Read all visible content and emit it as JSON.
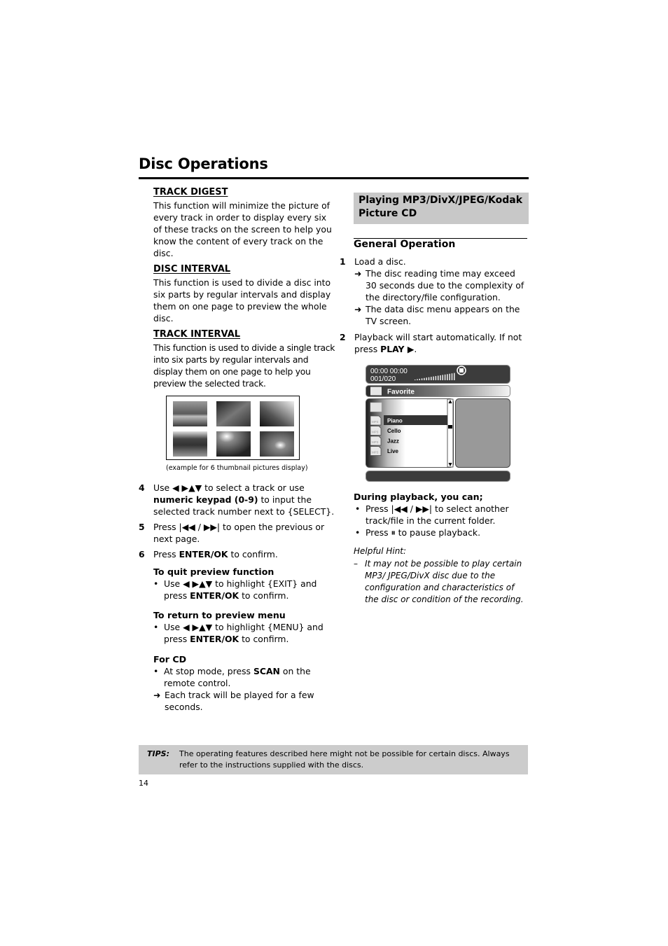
{
  "page": {
    "title": "Disc Operations",
    "page_number": "14"
  },
  "left": {
    "track_digest": {
      "heading": "TRACK DIGEST",
      "text": "This function will minimize the picture of every track in order to display every six of these tracks on the screen to help you know the content of every track on the disc."
    },
    "disc_interval": {
      "heading": "DISC INTERVAL",
      "text": "This function is used to divide a disc into six parts by regular intervals and display them on one page to preview the whole disc."
    },
    "track_interval": {
      "heading": "TRACK INTERVAL",
      "text": "This function is used to divide a single track into six parts by regular intervals and display them on one page to help you preview the selected track."
    },
    "thumbnail_caption": "(example for 6 thumbnail pictures display)",
    "steps": [
      {
        "num": "4",
        "pre": "Use ◀ ▶▲▼ to select a track or use ",
        "bold": "numeric keypad (0-9)",
        "post": " to input the selected track number next to {SELECT}."
      },
      {
        "num": "5",
        "pre": "Press |◀◀ / ▶▶| to open the previous or next page.",
        "bold": "",
        "post": ""
      },
      {
        "num": "6",
        "pre": "Press ",
        "bold": "ENTER/OK",
        "post": " to confirm."
      }
    ],
    "quit": {
      "heading": "To quit preview function",
      "pre": "Use ◀ ▶▲▼ to highlight {EXIT} and press ",
      "bold": "ENTER/OK",
      "post": " to confirm."
    },
    "return": {
      "heading": "To return to preview menu",
      "pre": "Use ◀ ▶▲▼ to highlight {MENU} and press ",
      "bold": "ENTER/OK",
      "post": " to confirm."
    },
    "cd": {
      "heading": "For CD",
      "pre": "At stop mode, press ",
      "bold": "SCAN",
      "post": " on the remote control.",
      "result": "Each track will be played for a few seconds."
    }
  },
  "right": {
    "banner": "Playing MP3/DivX/JPEG/Kodak Picture CD",
    "general_heading": "General Operation",
    "step1": {
      "num": "1",
      "text": "Load a disc.",
      "results": [
        "The disc reading time may exceed 30 seconds due to the complexity of the directory/file configuration.",
        "The data disc menu appears on the TV screen."
      ]
    },
    "step2": {
      "num": "2",
      "pre": "Playback will start automatically. If not press ",
      "bold": "PLAY ▶",
      "post": "."
    },
    "osd": {
      "time_elapsed": "00:00",
      "time_total": "00:00",
      "track_counter": "001/020",
      "folder": "Favorite",
      "files": [
        {
          "icon": "MP3",
          "name": "Piano",
          "selected": true
        },
        {
          "icon": "MP3",
          "name": "Cello",
          "selected": false
        },
        {
          "icon": "MP3",
          "name": "Jazz",
          "selected": false
        },
        {
          "icon": "MP3",
          "name": "Live",
          "selected": false
        }
      ]
    },
    "during": {
      "heading": "During playback, you can;",
      "bullets": [
        "Press |◀◀ / ▶▶| to select another track/file in the current folder.",
        "Press ⏸ to pause playback."
      ]
    },
    "hint": {
      "heading": "Helpful Hint:",
      "text": "It may not be possible to play certain MP3/ JPEG/DivX disc due to the configuration and characteristics of the disc or condition of the recording."
    }
  },
  "tips": {
    "label": "TIPS:",
    "text": "The operating features described here might not be possible for certain discs. Always refer to the instructions supplied with the discs."
  }
}
